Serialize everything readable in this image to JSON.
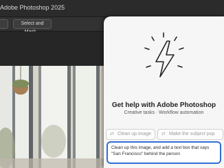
{
  "window": {
    "title": "Adobe Photoshop 2025"
  },
  "options_bar": {
    "select_and_mask_label": "Select and Mask..."
  },
  "assistant_panel": {
    "heading": "Get help with Adobe Photoshop",
    "subheading": "Creative tasks · Workflow automation",
    "icon": "lightning-bolt-icon",
    "suggestions": [
      {
        "label": "Clean up image",
        "icon": "wand-icon"
      },
      {
        "label": "Make the subject pop",
        "icon": "wand-icon"
      }
    ],
    "prompt_value": "Clean up this image, and add a text box that says \"San Francisco\" behind the person"
  },
  "colors": {
    "accent": "#2f6fd6",
    "panel_bg": "#f6f6f6",
    "app_bg": "#262626"
  }
}
